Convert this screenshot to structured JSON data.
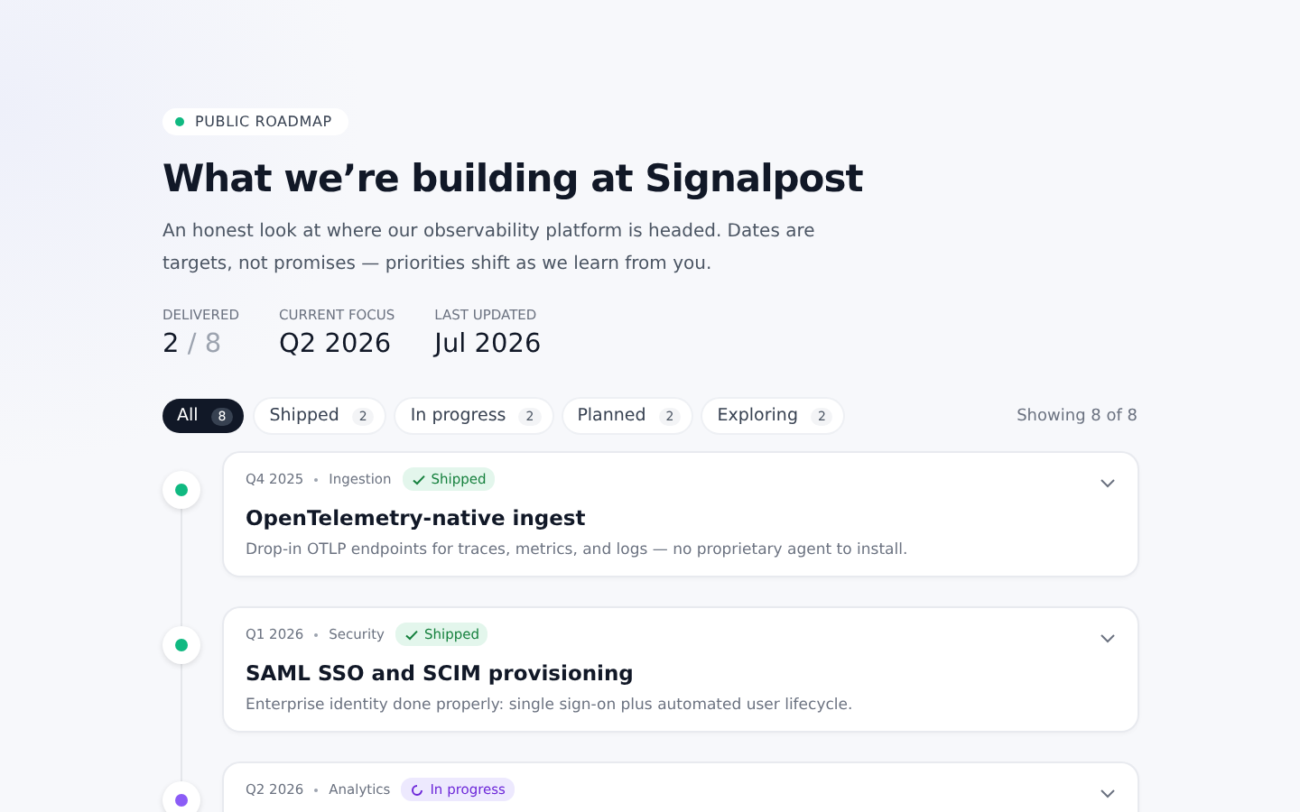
{
  "badge": {
    "label": "PUBLIC ROADMAP"
  },
  "title": "What we’re building at Signalpost",
  "intro": "An honest look at where our observability platform is headed. Dates are targets, not promises — priorities shift as we learn from you.",
  "stats": [
    {
      "label": "DELIVERED",
      "value": "2",
      "total": "/ 8"
    },
    {
      "label": "CURRENT FOCUS",
      "value": "Q2 2026"
    },
    {
      "label": "LAST UPDATED",
      "value": "Jul 2026"
    }
  ],
  "filters": [
    {
      "label": "All",
      "count": "8",
      "selected": true
    },
    {
      "label": "Shipped",
      "count": "2",
      "selected": false
    },
    {
      "label": "In progress",
      "count": "2",
      "selected": false
    },
    {
      "label": "Planned",
      "count": "2",
      "selected": false
    },
    {
      "label": "Exploring",
      "count": "2",
      "selected": false
    }
  ],
  "showing": "Showing 8 of 8",
  "items": [
    {
      "quarter": "Q4 2025",
      "area": "Ingestion",
      "status": {
        "kind": "shipped",
        "label": "Shipped"
      },
      "title": "OpenTelemetry-native ingest",
      "description": "Drop-in OTLP endpoints for traces, metrics, and logs — no proprietary agent to install."
    },
    {
      "quarter": "Q1 2026",
      "area": "Security",
      "status": {
        "kind": "shipped",
        "label": "Shipped"
      },
      "title": "SAML SSO and SCIM provisioning",
      "description": "Enterprise identity done properly: single sign-on plus automated user lifecycle."
    },
    {
      "quarter": "Q2 2026",
      "area": "Analytics",
      "status": {
        "kind": "in_progress",
        "label": "In progress"
      }
    }
  ]
}
